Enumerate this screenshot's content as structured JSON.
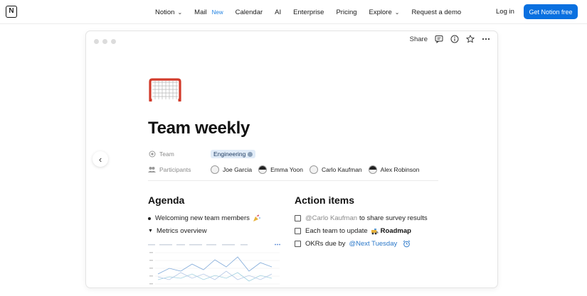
{
  "nav": {
    "logo": "N",
    "items": [
      {
        "label": "Notion",
        "has_dropdown": true
      },
      {
        "label": "Mail",
        "badge": "New"
      },
      {
        "label": "Calendar"
      },
      {
        "label": "AI"
      },
      {
        "label": "Enterprise"
      },
      {
        "label": "Pricing"
      },
      {
        "label": "Explore",
        "has_dropdown": true
      },
      {
        "label": "Request a demo"
      }
    ],
    "login": "Log in",
    "cta": "Get Notion free"
  },
  "window": {
    "toolbar": {
      "share": "Share",
      "icons": [
        "comment-icon",
        "info-icon",
        "star-icon",
        "more-icon"
      ]
    },
    "page": {
      "icon": "goal-net-icon",
      "title": "Team weekly",
      "properties": {
        "team_label": "Team",
        "team_value": "Engineering",
        "participants_label": "Participants",
        "participants": [
          "Joe Garcia",
          "Emma Yoon",
          "Carlo Kaufman",
          "Alex Robinson"
        ]
      },
      "agenda": {
        "heading": "Agenda",
        "items": [
          "Welcoming new team members",
          "Metrics overview"
        ]
      },
      "actions": {
        "heading": "Action items",
        "item1_mention": "@Carlo Kaufman",
        "item1_text": "to share survey results",
        "item2_text": "Each team to update",
        "item2_link": "Roadmap",
        "item3_text": "OKRs due by",
        "item3_date": "@Next Tuesday"
      }
    }
  },
  "colors": {
    "accent": "#0a70e0",
    "mention_blue": "#2b78c9",
    "tag_bg": "#e1ecf8"
  }
}
